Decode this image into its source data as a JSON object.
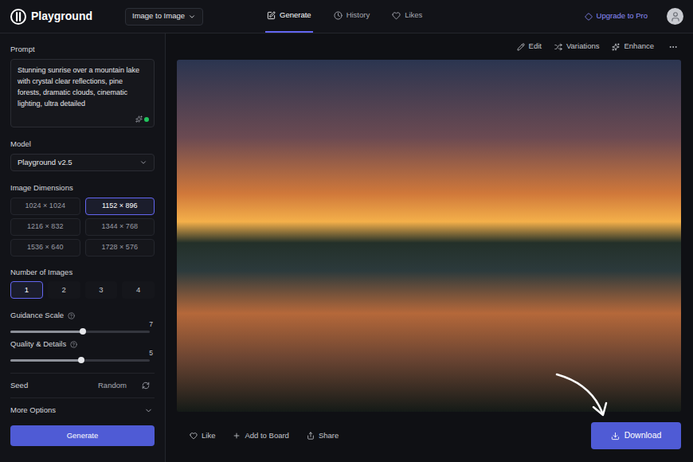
{
  "header": {
    "logo": "Playground",
    "mode_dropdown": "Image to Image",
    "nav": [
      {
        "label": "Generate",
        "selected": true
      },
      {
        "label": "History",
        "selected": false
      },
      {
        "label": "Likes",
        "selected": false
      }
    ],
    "upgrade": "Upgrade to Pro"
  },
  "sidebar": {
    "prompt": {
      "label": "Prompt",
      "value": "Stunning sunrise over a mountain lake with crystal clear reflections, pine forests, dramatic clouds, cinematic lighting, ultra detailed"
    },
    "model": {
      "label": "Model",
      "value": "Playground v2.5"
    },
    "dimensions": {
      "label": "Image Dimensions",
      "options": [
        {
          "label": "1024 × 1024",
          "selected": false
        },
        {
          "label": "1152 × 896",
          "selected": true
        },
        {
          "label": "1216 × 832",
          "selected": false
        },
        {
          "label": "1344 × 768",
          "selected": false
        },
        {
          "label": "1536 × 640",
          "selected": false
        },
        {
          "label": "1728 × 576",
          "selected": false
        }
      ]
    },
    "number_of_images": {
      "label": "Number of Images",
      "options": [
        {
          "label": "1",
          "selected": true
        },
        {
          "label": "2",
          "selected": false
        },
        {
          "label": "3",
          "selected": false
        },
        {
          "label": "4",
          "selected": false
        }
      ]
    },
    "sliders": [
      {
        "label": "Guidance Scale",
        "value": "7",
        "level": 0.52
      },
      {
        "label": "Quality & Details",
        "value": "5",
        "level": 0.51
      }
    ],
    "seed": {
      "label": "Seed",
      "value": "Random"
    },
    "more_options": "More Options",
    "generate": "Generate"
  },
  "toolbar": [
    "Edit",
    "Variations",
    "Enhance"
  ],
  "actions": [
    "Like",
    "Add to Board",
    "Share"
  ],
  "download": "Download"
}
